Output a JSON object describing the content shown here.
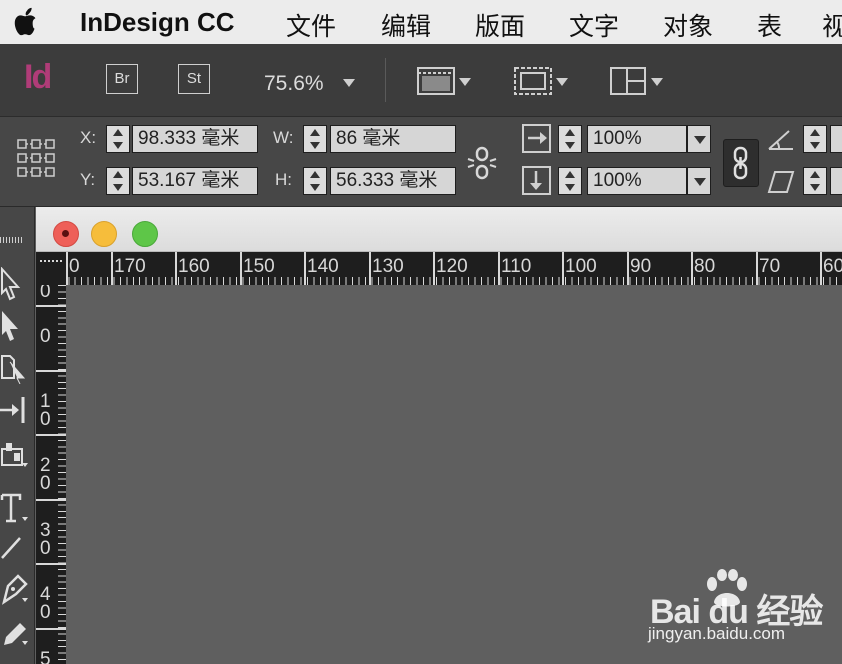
{
  "menubar": {
    "app_name": "InDesign CC",
    "items": [
      "文件",
      "编辑",
      "版面",
      "文字",
      "对象",
      "表",
      "视"
    ]
  },
  "appbar": {
    "logo": "Id",
    "bridge": "Br",
    "stock": "St",
    "zoom": "75.6%"
  },
  "control": {
    "x_label": "X:",
    "x_value": "98.333 毫米",
    "y_label": "Y:",
    "y_value": "53.167 毫米",
    "w_label": "W:",
    "w_value": "86 毫米",
    "h_label": "H:",
    "h_value": "56.333 毫米",
    "scale_x": "100%",
    "scale_y": "100%"
  },
  "ruler": {
    "h_labels": [
      "0",
      "170",
      "160",
      "150",
      "140",
      "130",
      "120",
      "110",
      "100",
      "90",
      "80",
      "70",
      "60"
    ],
    "v_labels": [
      [
        "0"
      ],
      [
        "0"
      ],
      [
        "1",
        "0"
      ],
      [
        "2",
        "0"
      ],
      [
        "3",
        "0"
      ],
      [
        "4",
        "0"
      ],
      [
        "5"
      ]
    ]
  },
  "colors": {
    "traffic_close": "#ee5f58",
    "traffic_min": "#f6bd3b",
    "traffic_max": "#5ec648",
    "id_brand": "#b03c78"
  },
  "watermark": {
    "logo_text": "Bai du 经验",
    "url": "jingyan.baidu.com"
  }
}
